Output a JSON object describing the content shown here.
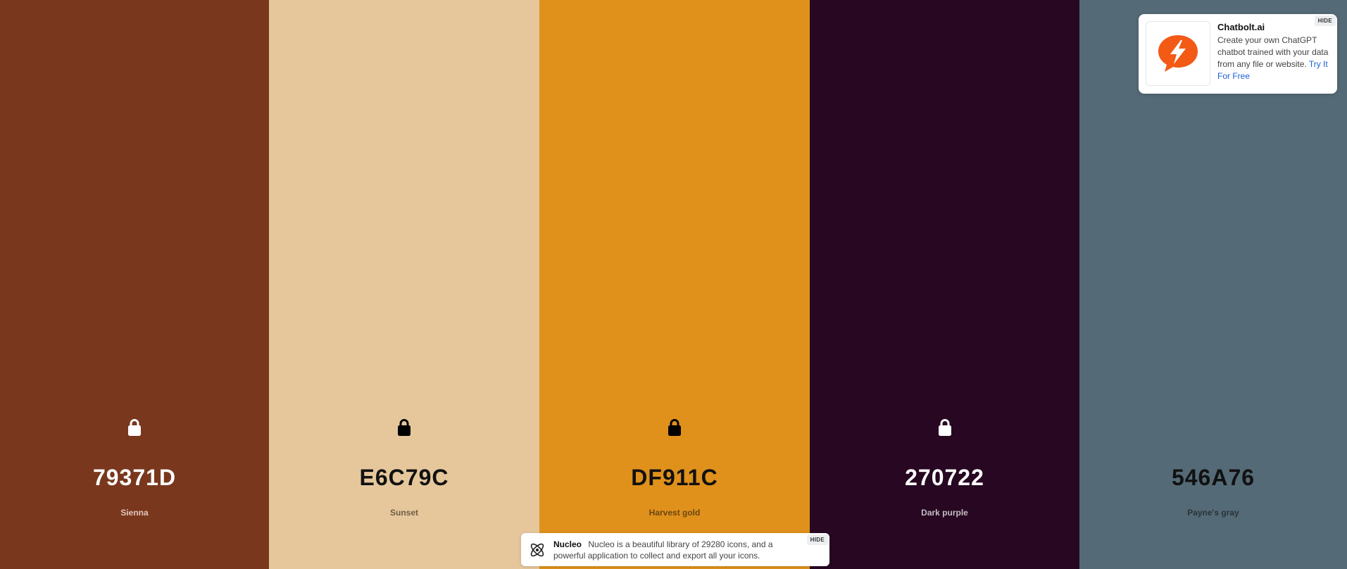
{
  "palette": {
    "colors": [
      {
        "hex": "79371D",
        "name": "Sienna",
        "bg": "#79371D",
        "text_color": "#ffffff",
        "name_color": "#e3c8bc",
        "lock_color": "#ffffff"
      },
      {
        "hex": "E6C79C",
        "name": "Sunset",
        "bg": "#E6C79C",
        "text_color": "#111111",
        "name_color": "#6f5d46",
        "lock_color": "#000000"
      },
      {
        "hex": "DF911C",
        "name": "Harvest gold",
        "bg": "#DF911C",
        "text_color": "#111111",
        "name_color": "#6d4710",
        "lock_color": "#000000"
      },
      {
        "hex": "270722",
        "name": "Dark purple",
        "bg": "#270722",
        "text_color": "#ffffff",
        "name_color": "#c4bcc2",
        "lock_color": "#ffffff"
      },
      {
        "hex": "546A76",
        "name": "Payne's gray",
        "bg": "#546A76",
        "text_color": "#111111",
        "name_color": "#2a3439",
        "lock_color": "#546A76"
      }
    ]
  },
  "ad": {
    "title": "Chatbolt.ai",
    "body": "Create your own ChatGPT chatbot trained with your data from any file or website.",
    "link": "Try It For Free",
    "hide_label": "HIDE",
    "logo_icon": "lightning-chat-icon",
    "accent": "#F25A16"
  },
  "banner": {
    "title": "Nucleo",
    "body": "Nucleo is a beautiful library of 29280 icons, and a powerful application to collect and export all your icons.",
    "hide_label": "HIDE",
    "icon": "atom-icon"
  }
}
